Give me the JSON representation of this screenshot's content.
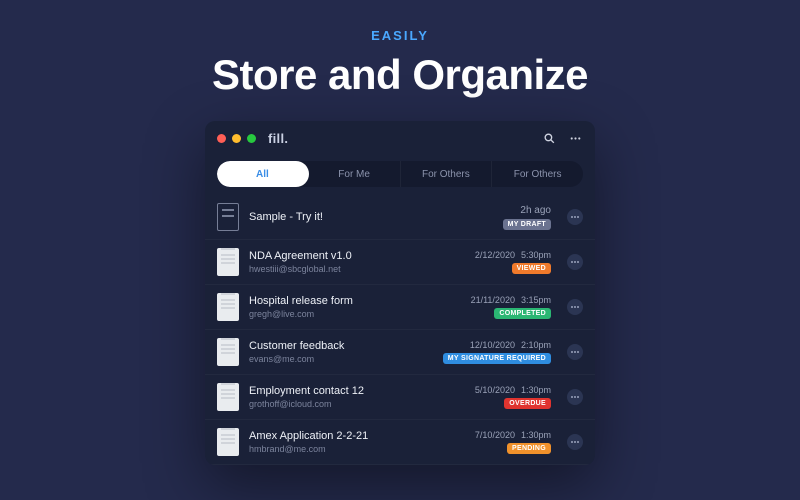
{
  "hero": {
    "eyebrow": "EASILY",
    "title": "Store and Organize"
  },
  "app": {
    "brand": "fill.",
    "tabs": [
      {
        "label": "All",
        "active": true
      },
      {
        "label": "For Me",
        "active": false
      },
      {
        "label": "For Others",
        "active": false
      },
      {
        "label": "For Others",
        "active": false
      }
    ],
    "badge_colors": {
      "MY DRAFT": "#6b7390",
      "VIEWED": "#f07a2b",
      "COMPLETED": "#2bb673",
      "MY SIGNATURE REQUIRED": "#2f8de0",
      "OVERDUE": "#e0342f",
      "PENDING": "#f0912b"
    },
    "rows": [
      {
        "icon": "outline",
        "title": "Sample - Try it!",
        "subtitle": "",
        "date": "",
        "time": "",
        "ago": "2h ago",
        "badge": "MY DRAFT"
      },
      {
        "icon": "doc",
        "title": "NDA Agreement v1.0",
        "subtitle": "hwestiii@sbcglobal.net",
        "date": "2/12/2020",
        "time": "5:30pm",
        "ago": "",
        "badge": "VIEWED"
      },
      {
        "icon": "doc",
        "title": "Hospital release form",
        "subtitle": "gregh@live.com",
        "date": "21/11/2020",
        "time": "3:15pm",
        "ago": "",
        "badge": "COMPLETED"
      },
      {
        "icon": "doc",
        "title": "Customer feedback",
        "subtitle": "evans@me.com",
        "date": "12/10/2020",
        "time": "2:10pm",
        "ago": "",
        "badge": "MY SIGNATURE REQUIRED"
      },
      {
        "icon": "doc",
        "title": "Employment contact 12",
        "subtitle": "grothoff@icloud.com",
        "date": "5/10/2020",
        "time": "1:30pm",
        "ago": "",
        "badge": "OVERDUE"
      },
      {
        "icon": "doc",
        "title": "Amex Application 2-2-21",
        "subtitle": "hmbrand@me.com",
        "date": "7/10/2020",
        "time": "1:30pm",
        "ago": "",
        "badge": "PENDING"
      }
    ]
  }
}
